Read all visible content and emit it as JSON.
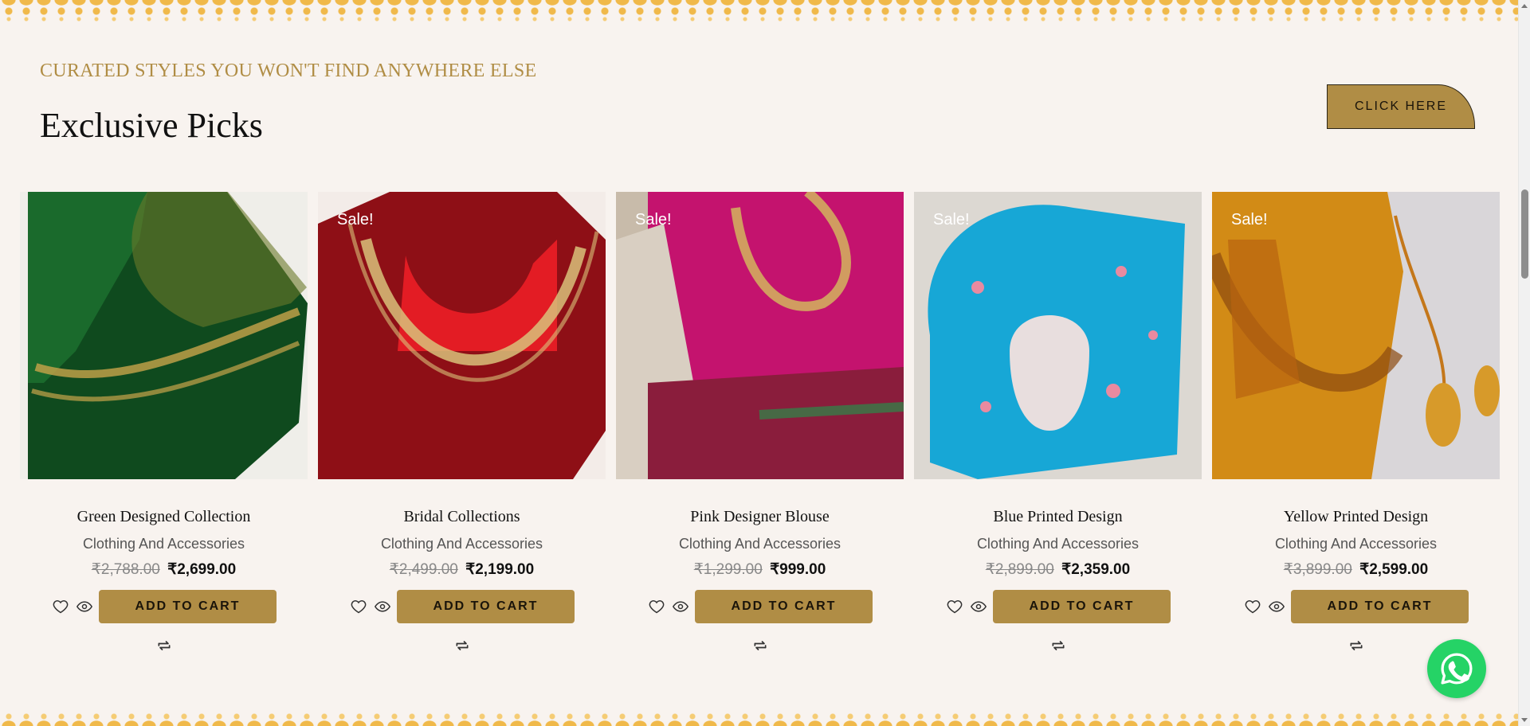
{
  "section": {
    "eyebrow": "CURATED STYLES YOU WON'T FIND ANYWHERE ELSE",
    "heading": "Exclusive Picks",
    "cta_label": "CLICK HERE"
  },
  "colors": {
    "accent": "#b08d45",
    "background": "#f8f3ef",
    "whatsapp": "#25d366"
  },
  "products": [
    {
      "sale_badge": "",
      "title": "Green Designed Collection",
      "category": "Clothing And Accessories",
      "old_price": "₹2,788.00",
      "new_price": "₹2,699.00",
      "add_to_cart": "ADD TO CART",
      "image_color": "#0f4a1e"
    },
    {
      "sale_badge": "Sale!",
      "title": "Bridal Collections",
      "category": "Clothing And Accessories",
      "old_price": "₹2,499.00",
      "new_price": "₹2,199.00",
      "add_to_cart": "ADD TO CART",
      "image_color": "#b4141c"
    },
    {
      "sale_badge": "Sale!",
      "title": "Pink Designer Blouse",
      "category": "Clothing And Accessories",
      "old_price": "₹1,299.00",
      "new_price": "₹999.00",
      "add_to_cart": "ADD TO CART",
      "image_color": "#c4136e"
    },
    {
      "sale_badge": "Sale!",
      "title": "Blue Printed Design",
      "category": "Clothing And Accessories",
      "old_price": "₹2,899.00",
      "new_price": "₹2,359.00",
      "add_to_cart": "ADD TO CART",
      "image_color": "#17a7d6"
    },
    {
      "sale_badge": "Sale!",
      "title": "Yellow Printed Design",
      "category": "Clothing And Accessories",
      "old_price": "₹3,899.00",
      "new_price": "₹2,599.00",
      "add_to_cart": "ADD TO CART",
      "image_color": "#d28b16"
    }
  ],
  "icons": {
    "wishlist": "heart-icon",
    "quick_view": "eye-icon",
    "compare": "compare-icon",
    "chat": "whatsapp-icon"
  }
}
